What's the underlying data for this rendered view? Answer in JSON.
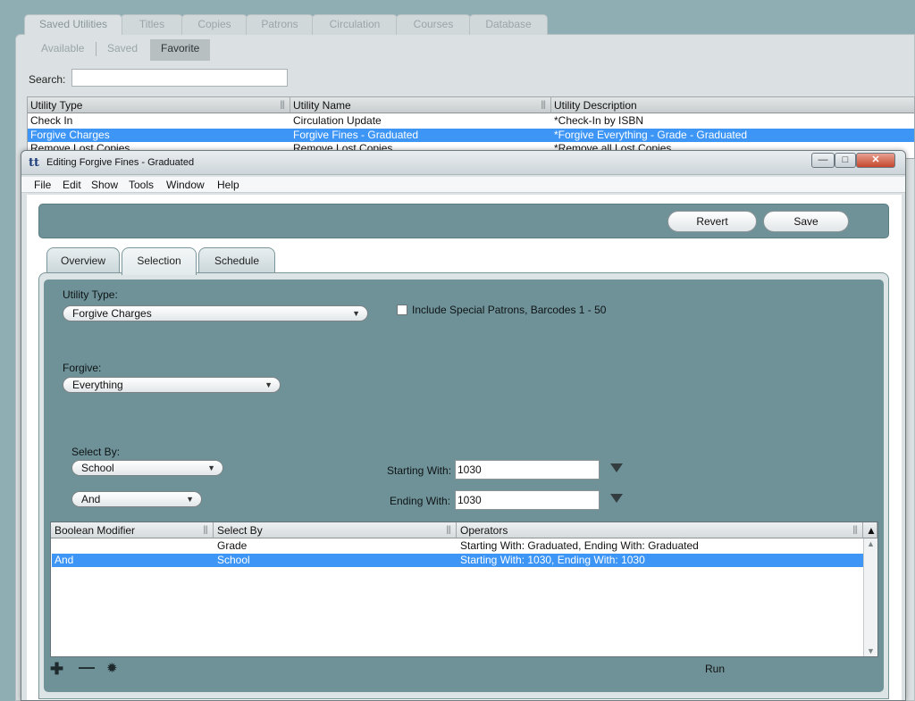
{
  "main_tabs": [
    "Saved Utilities",
    "Titles",
    "Copies",
    "Patrons",
    "Circulation",
    "Courses",
    "Database"
  ],
  "sub_tabs": [
    "Available",
    "Saved",
    "Favorite"
  ],
  "search": {
    "label": "Search:",
    "value": ""
  },
  "bg_table": {
    "headers": [
      "Utility Type",
      "Utility Name",
      "Utility Description"
    ],
    "rows": [
      [
        "Check In",
        "Circulation Update",
        "*Check-In by ISBN"
      ],
      [
        "Forgive Charges",
        "Forgive Fines - Graduated",
        "*Forgive Everything - Grade - Graduated"
      ],
      [
        "Remove Lost Copies",
        "Remove Lost Copies",
        "*Remove all Lost Copies"
      ]
    ]
  },
  "dialog": {
    "app_icon": "tt",
    "title": "Editing Forgive Fines - Graduated",
    "menu": [
      "File",
      "Edit",
      "Show",
      "Tools",
      "Window",
      "Help"
    ],
    "revert_label": "Revert",
    "save_label": "Save",
    "tabs": [
      "Overview",
      "Selection",
      "Schedule"
    ]
  },
  "selection": {
    "utility_type_label": "Utility Type:",
    "utility_type_value": "Forgive Charges",
    "include_special_label": "Include Special Patrons, Barcodes 1 - 50",
    "forgive_label": "Forgive:",
    "forgive_value": "Everything",
    "select_by_label": "Select By:",
    "select_by_value": "School",
    "boolean_value": "And",
    "starting_with_label": "Starting With:",
    "starting_with_value": "1030",
    "ending_with_label": "Ending With:",
    "ending_with_value": "1030"
  },
  "criteria_table": {
    "headers": [
      "Boolean Modifier",
      "Select By",
      "Operators"
    ],
    "rows": [
      [
        "",
        "Grade",
        "Starting With: Graduated, Ending With: Graduated"
      ],
      [
        "And",
        "School",
        "Starting With: 1030, Ending With: 1030"
      ]
    ]
  },
  "bottom": {
    "run_label": "Run"
  },
  "icons": [
    "add-icon",
    "remove-icon",
    "gear-icon",
    "app-icon",
    "minimize-icon",
    "maximize-icon",
    "close-icon",
    "dropdown-arrow-icon",
    "scroll-up-icon",
    "scroll-down-icon"
  ],
  "colors": {
    "accent_teal": "#6f9298",
    "selection_blue": "#3d95f5",
    "background": "#8faeb4"
  }
}
